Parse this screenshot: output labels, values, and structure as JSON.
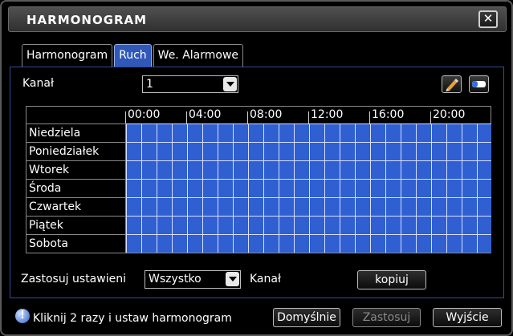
{
  "window": {
    "title": "HARMONOGRAM",
    "close_glyph": "✕"
  },
  "tabs": [
    {
      "label": "Harmonogram",
      "active": false
    },
    {
      "label": "Ruch",
      "active": true
    },
    {
      "label": "We. Alarmowe",
      "active": false
    }
  ],
  "channel": {
    "label": "Kanał",
    "value": "1"
  },
  "icons": {
    "edit": "pencil-icon",
    "erase": "eraser-icon"
  },
  "schedule": {
    "hours": [
      "00:00",
      "04:00",
      "08:00",
      "12:00",
      "16:00",
      "20:00"
    ],
    "days": [
      "Niedziela",
      "Poniedziałek",
      "Wtorek",
      "Środa",
      "Czwartek",
      "Piątek",
      "Sobota"
    ],
    "fill_color": "#2f5fd0",
    "grid_color": "#d6e0ff"
  },
  "apply": {
    "label": "Zastosuj ustawieni",
    "value": "Wszystko",
    "channel_label": "Kanał",
    "copy_button": "kopiuj"
  },
  "footer": {
    "hint": "Kliknij 2 razy i ustaw harmonogram",
    "default_button": "Domyślnie",
    "apply_button": "Zastosuj",
    "exit_button": "Wyjście"
  },
  "colors": {
    "accent": "#2f58b8",
    "background": "#000000"
  }
}
